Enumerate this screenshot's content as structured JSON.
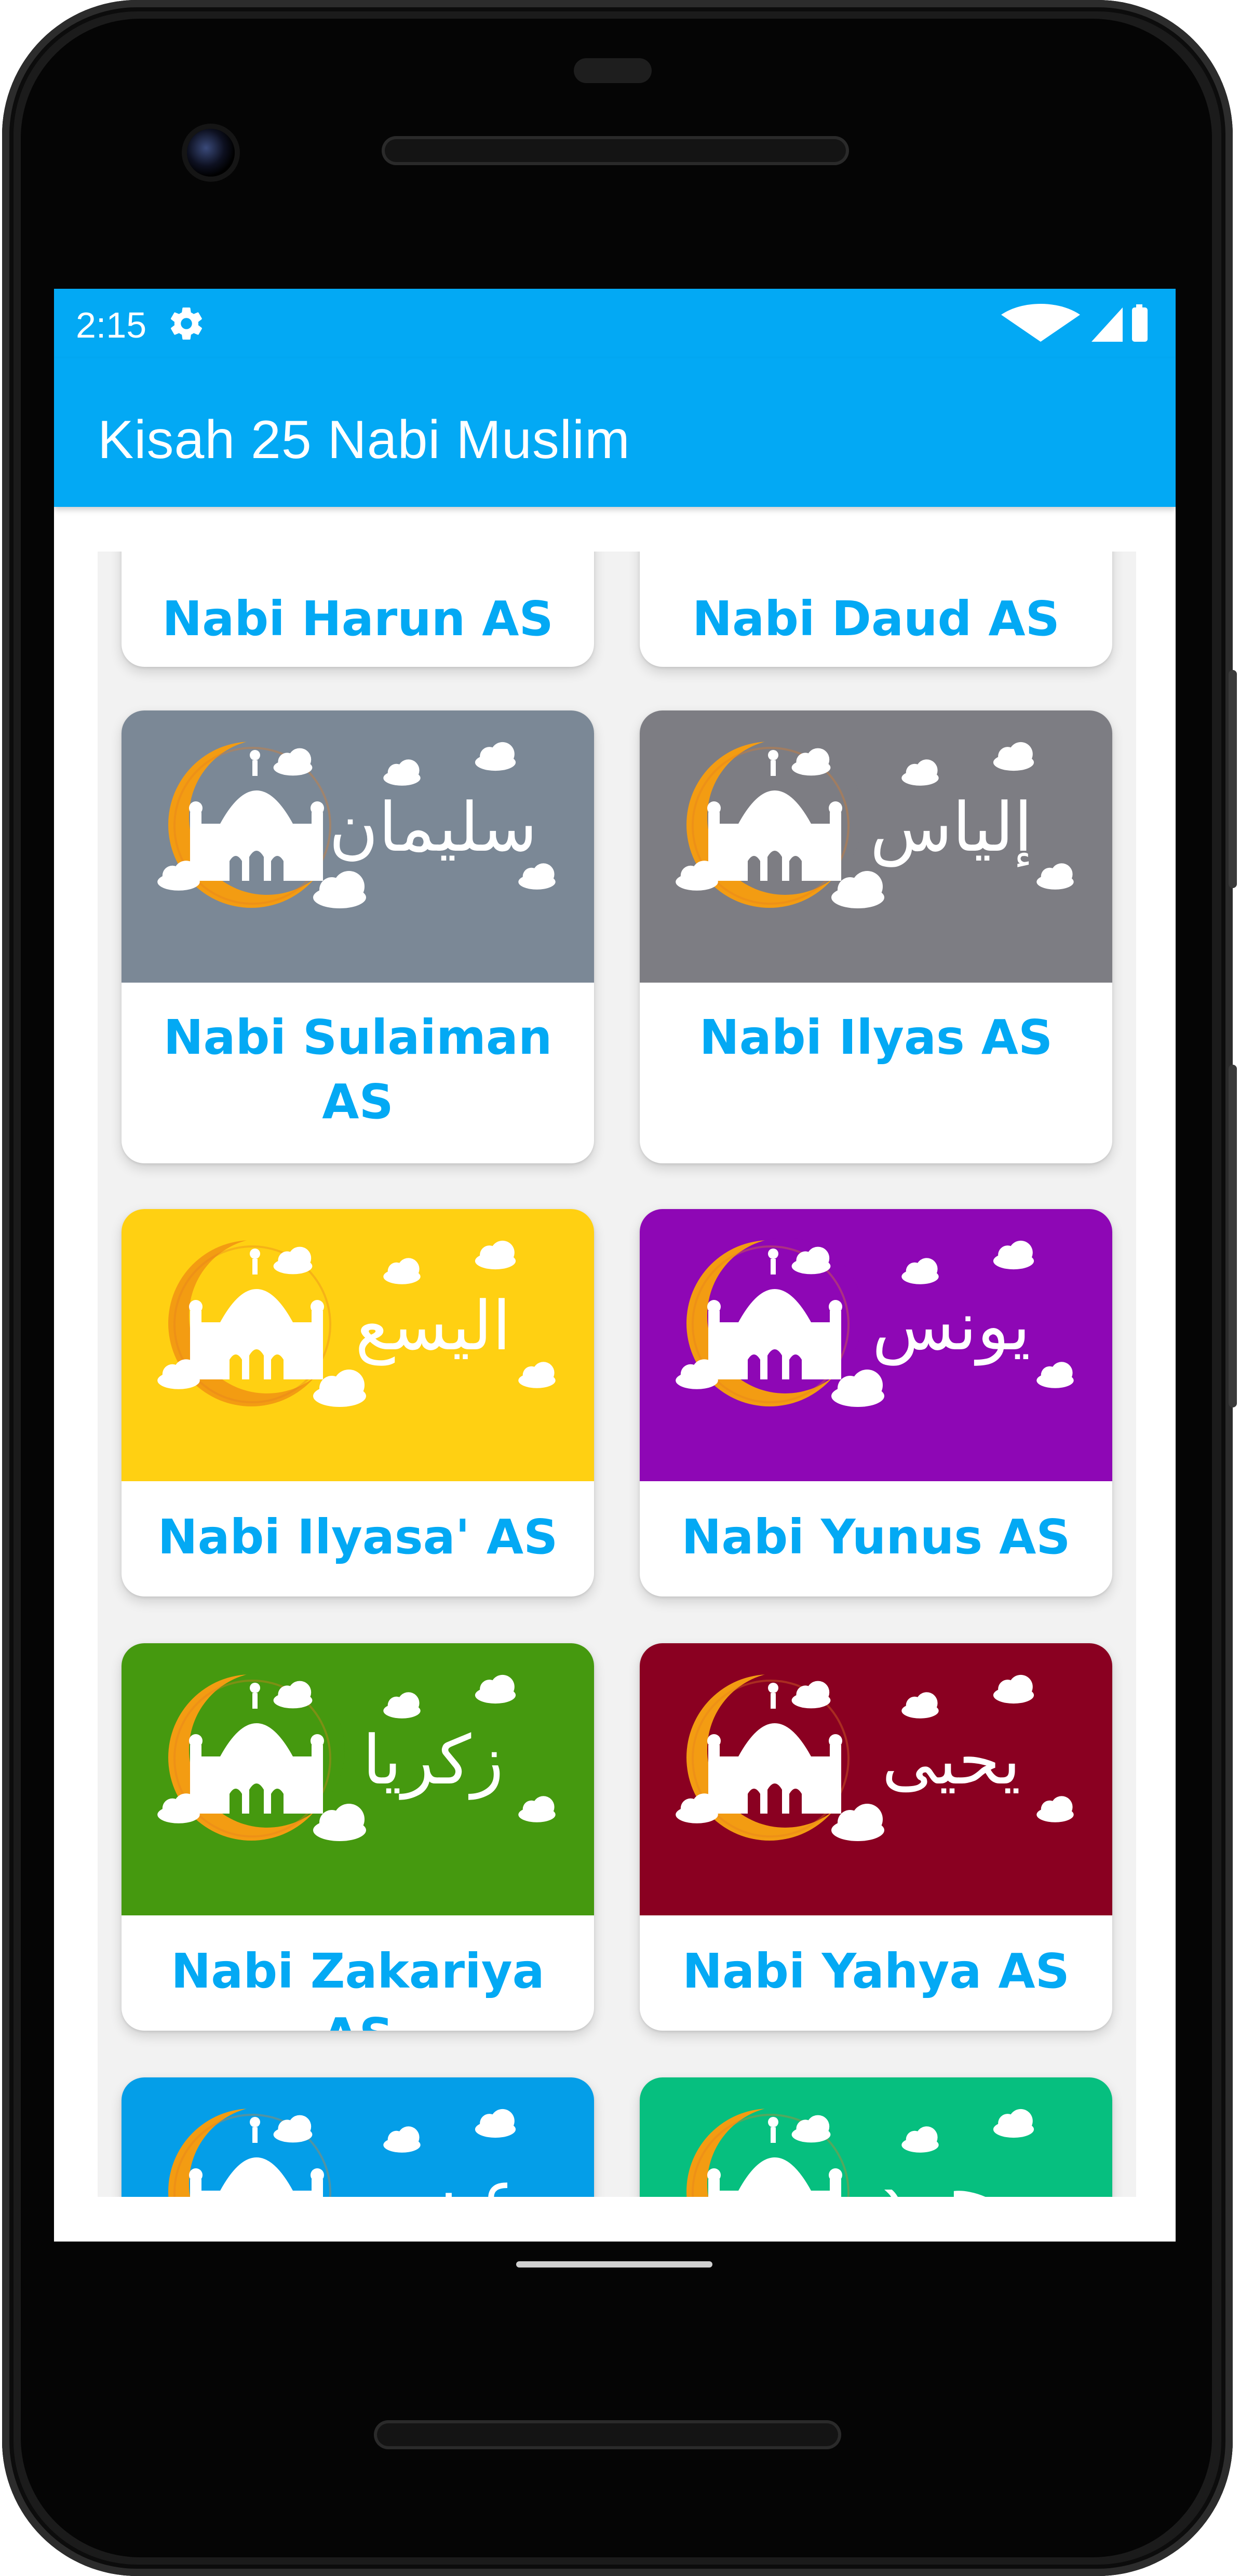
{
  "status_bar": {
    "time": "2:15",
    "settings_icon": "gear-icon",
    "wifi_icon": "wifi-icon",
    "signal_icon": "cellular-signal-icon",
    "battery_icon": "battery-icon"
  },
  "app_bar": {
    "title": "Kisah 25 Nabi Muslim"
  },
  "colors": {
    "accent": "#03a9f4",
    "label_text": "#03a9f4"
  },
  "prophets": [
    {
      "label": "Nabi Harun AS",
      "arabic": "",
      "color": "#03a9f4"
    },
    {
      "label": "Nabi Daud AS",
      "arabic": "",
      "color": "#03a9f4"
    },
    {
      "label": "Nabi Sulaiman AS",
      "arabic": "سليمان",
      "color": "#7b8896"
    },
    {
      "label": "Nabi Ilyas AS",
      "arabic": "إلياس",
      "color": "#7d7d83"
    },
    {
      "label": "Nabi Ilyasa' AS",
      "arabic": "اليسع",
      "color": "#ffd012"
    },
    {
      "label": "Nabi Yunus AS",
      "arabic": "يونس",
      "color": "#8e07b5"
    },
    {
      "label": "Nabi Zakariya AS",
      "arabic": "زكريا",
      "color": "#45990f"
    },
    {
      "label": "Nabi Yahya AS",
      "arabic": "يحيى",
      "color": "#8a0021"
    },
    {
      "label": "",
      "arabic": "عيسى",
      "color": "#049ee8"
    },
    {
      "label": "",
      "arabic": "محمد",
      "color": "#06bf7f"
    }
  ]
}
